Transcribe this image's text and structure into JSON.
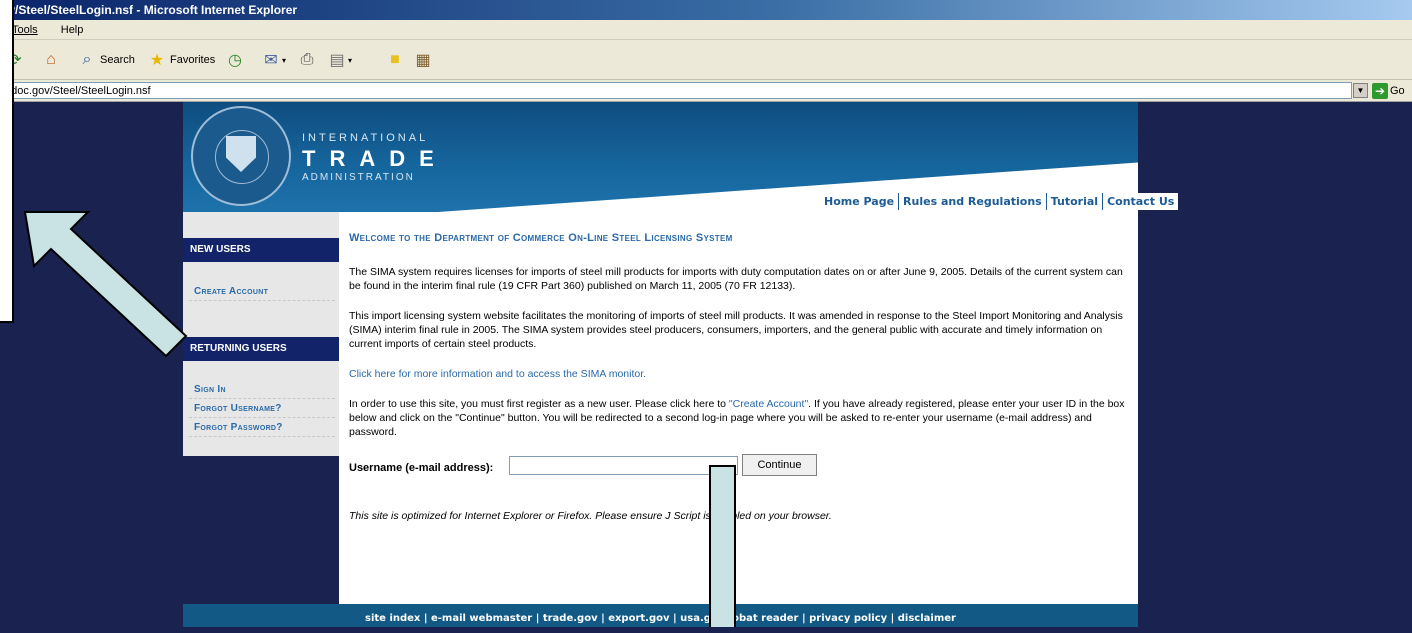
{
  "browser": {
    "title": "ov/Steel/SteelLogin.nsf - Microsoft Internet Explorer",
    "menu": [
      "Tools",
      "Help"
    ],
    "toolbar": {
      "search_label": "Search",
      "favorites_label": "Favorites"
    },
    "address": "a.doc.gov/Steel/SteelLogin.nsf",
    "go_label": "Go"
  },
  "header": {
    "line1": "INTERNATIONAL",
    "line2": "TRADE",
    "line3": "ADMINISTRATION",
    "nav": [
      "Home Page",
      "Rules and Regulations",
      "Tutorial",
      "Contact Us"
    ]
  },
  "sidebar": {
    "new_users_heading": "NEW USERS",
    "create_account": "Create Account",
    "returning_heading": "RETURNING USERS",
    "sign_in": "Sign In",
    "forgot_username": "Forgot Username?",
    "forgot_password": "Forgot Password?"
  },
  "main": {
    "welcome": "Welcome to the Department of Commerce On-Line Steel Licensing System",
    "p1": "The SIMA system requires licenses for imports of steel mill products for imports with duty computation dates on or after June 9, 2005. Details of the current system can be found in the interim final rule (19 CFR Part 360) published on March 11, 2005 (70 FR 12133).",
    "p2": "This import licensing system website facilitates the monitoring of imports of steel mill products. It was amended in response to the Steel Import Monitoring and Analysis (SIMA) interim final rule in 2005. The SIMA system provides steel producers, consumers, importers, and the general public with accurate and timely information on current imports of certain steel products.",
    "monitor_link": "Click here for more information and to access the SIMA monitor.",
    "p4_a": "In order to use this site, you must first register as a new user. Please click here to ",
    "p4_link": "\"Create Account\"",
    "p4_b": ". If you have already registered, please enter your user ID in the box below and click on the \"Continue\" button. You will be redirected to a second log-in page where you will be asked to re-enter your username (e-mail address) and password.",
    "username_label": "Username (e-mail address):",
    "username_value": "",
    "continue_label": "Continue",
    "optimized_note": "This site is optimized for Internet Explorer or Firefox. Please ensure J      Script is enabled on your browser."
  },
  "footer": {
    "text": "site index | e-mail webmaster | trade.gov | export.gov | usa.go      crobat reader | privacy policy | disclaimer"
  },
  "colors": {
    "background": "#1a2350",
    "nav_heading": "#12236a",
    "link": "#2a69a8",
    "arrow_fill": "#c9e3e5"
  }
}
